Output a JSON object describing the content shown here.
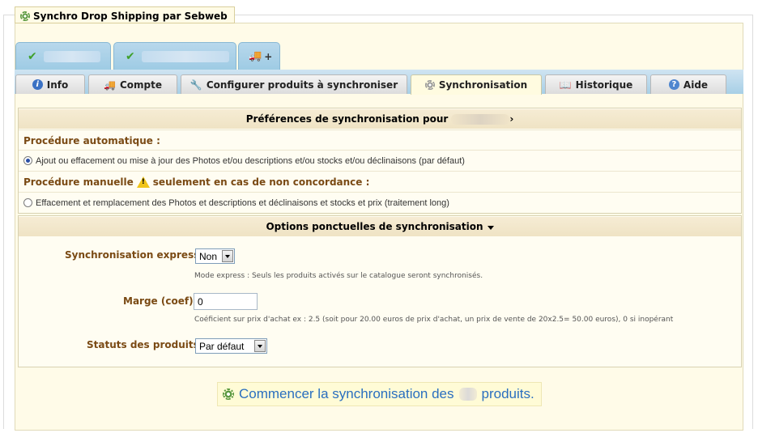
{
  "legend": {
    "title": "Synchro Drop Shipping par Sebweb"
  },
  "shop_tabs": [
    {
      "check": "✔"
    },
    {
      "check": "✔"
    },
    {
      "add_label": "+"
    }
  ],
  "tabs": [
    {
      "label": "Info",
      "icon": "info-icon"
    },
    {
      "label": "Compte",
      "icon": "truck-icon"
    },
    {
      "label": "Configurer produits à synchroniser",
      "icon": "wrench-icon"
    },
    {
      "label": "Synchronisation",
      "icon": "gear-icon",
      "active": true
    },
    {
      "label": "Historique",
      "icon": "book-icon"
    },
    {
      "label": "Aide",
      "icon": "help-icon"
    }
  ],
  "preferences": {
    "heading_prefix": "Préférences de synchronisation pour",
    "heading_suffix": "›",
    "auto_label": "Procédure automatique :",
    "auto_option": "Ajout ou effacement ou mise à jour des Photos et/ou descriptions et/ou stocks et/ou déclinaisons (par défaut)",
    "manual_label_a": "Procédure manuelle",
    "manual_label_b": "seulement en cas de non concordance :",
    "manual_option": "Effacement et remplacement des Photos et descriptions et déclinaisons et stocks et prix (traitement long)"
  },
  "options": {
    "heading": "Options ponctuelles de synchronisation",
    "express_label": "Synchronisation express :",
    "express_value": "Non",
    "express_hint": "Mode express : Seuls les produits activés sur le catalogue seront synchronisés.",
    "marge_label": "Marge (coef):",
    "marge_value": "0",
    "marge_hint": "Coéficient sur prix d'achat ex : 2.5 (soit pour 20.00 euros de prix d'achat, un prix de vente de 20x2.5= 50.00 euros), 0 si inopérant",
    "status_label": "Statuts des produits :",
    "status_value": "Par défaut"
  },
  "start_button": {
    "label_a": "Commencer la synchronisation des",
    "label_b": "produits."
  },
  "colors": {
    "accent_blue": "#2a6fbf",
    "label_brown": "#7a4a14",
    "tab_blue": "#a7cfe6"
  }
}
